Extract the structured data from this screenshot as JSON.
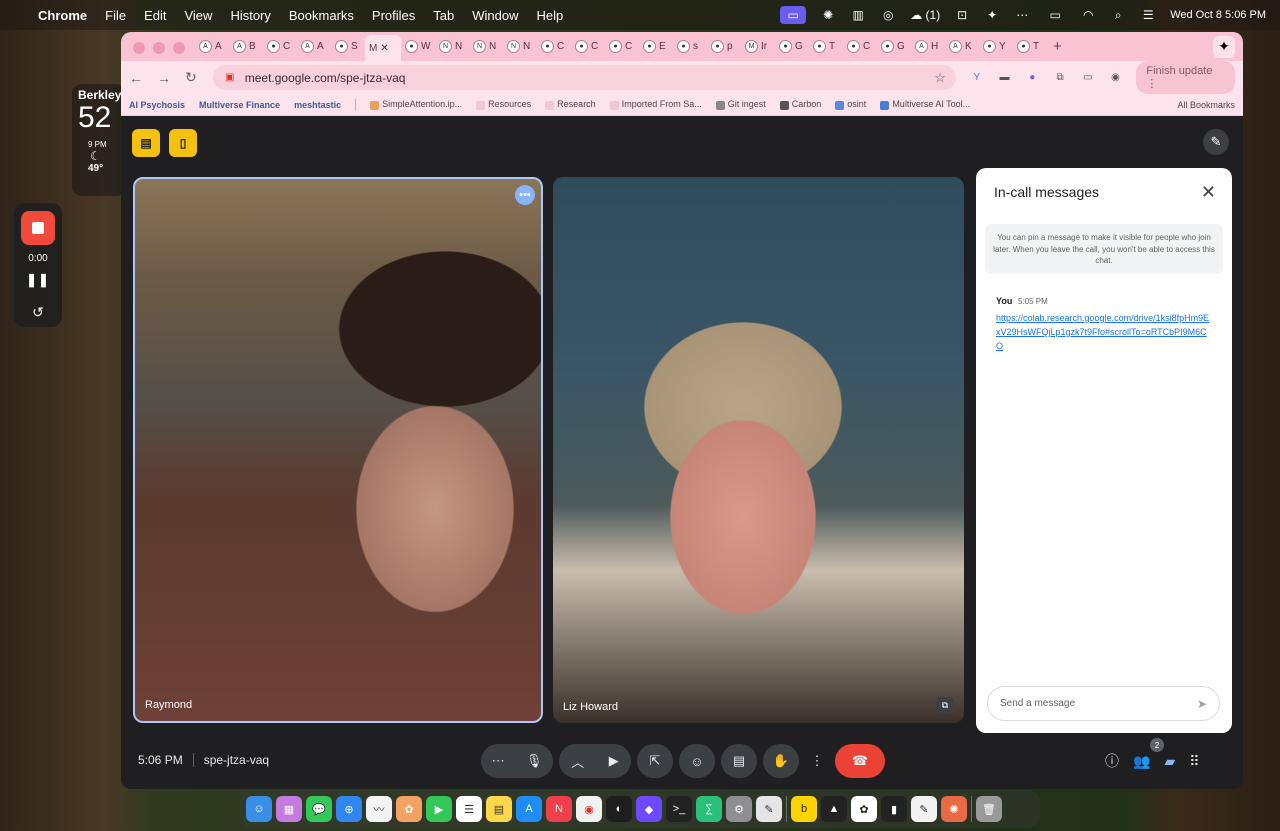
{
  "menubar": {
    "app_name": "Chrome",
    "menus": [
      "File",
      "Edit",
      "View",
      "History",
      "Bookmarks",
      "Profiles",
      "Tab",
      "Window",
      "Help"
    ],
    "status_item_count": "(1)",
    "datetime": "Wed Oct 8  5:06 PM"
  },
  "weather": {
    "city": "Berkley",
    "temp": "52",
    "hour": "9 PM",
    "hour_temp": "49°"
  },
  "recorder": {
    "time": "0:00"
  },
  "browser": {
    "tabs": [
      {
        "letter": "A",
        "fav": "A"
      },
      {
        "letter": "B",
        "fav": "A"
      },
      {
        "letter": "C",
        "fav": "●"
      },
      {
        "letter": "A",
        "fav": "A"
      },
      {
        "letter": "S",
        "fav": "●"
      },
      {
        "letter": "M",
        "fav": "",
        "active": true
      },
      {
        "letter": "W",
        "fav": "●"
      },
      {
        "letter": "N",
        "fav": "N"
      },
      {
        "letter": "N",
        "fav": "N"
      },
      {
        "letter": "N",
        "fav": "N"
      },
      {
        "letter": "C",
        "fav": "●"
      },
      {
        "letter": "C",
        "fav": "●"
      },
      {
        "letter": "C",
        "fav": "●"
      },
      {
        "letter": "E",
        "fav": "●"
      },
      {
        "letter": "s",
        "fav": "●"
      },
      {
        "letter": "p",
        "fav": "●"
      },
      {
        "letter": "Ir",
        "fav": "M"
      },
      {
        "letter": "G",
        "fav": "●"
      },
      {
        "letter": "T",
        "fav": "●"
      },
      {
        "letter": "C",
        "fav": "●"
      },
      {
        "letter": "G",
        "fav": "●"
      },
      {
        "letter": "H",
        "fav": "A"
      },
      {
        "letter": "K",
        "fav": "A"
      },
      {
        "letter": "Y",
        "fav": "●"
      },
      {
        "letter": "T",
        "fav": "●"
      }
    ],
    "url": "meet.google.com/spe-jtza-vaq",
    "finish_update": "Finish update",
    "bookmarks": [
      "AI Psychosis",
      "Multiverse Finance",
      "meshtastic",
      "SimpleAttention.ip...",
      "Resources",
      "Research",
      "Imported From Sa...",
      "Git ingest",
      "Carbon",
      "osint",
      "Multiverse AI Tool..."
    ],
    "all_bookmarks": "All Bookmarks"
  },
  "meet": {
    "participants": [
      {
        "name": "Raymond"
      },
      {
        "name": "Liz Howard"
      }
    ],
    "time": "5:06 PM",
    "meeting_code": "spe-jtza-vaq",
    "people_count": "2",
    "chat": {
      "title": "In-call messages",
      "info": "You can pin a message to make it visible for people who join later. When you leave the call, you won't be able to access this chat.",
      "messages": [
        {
          "sender": "You",
          "time": "5:05 PM",
          "text": "https://colab.research.google.com/drive/1ksi8fpHm9ExV29HsWFQjLp1gzk7t9Ffo#scrollTo=oRTCbPI9M6CO"
        }
      ],
      "input_placeholder": "Send a message"
    }
  },
  "colors": {
    "tabstrip": "#f9c3d3",
    "toolbar": "#fde3eb",
    "meet_bg": "#1f1f22",
    "end_call": "#ea4335",
    "active_speaker_border": "#a8c7fa",
    "link": "#1a73e8"
  },
  "icons": {
    "menubar_right": [
      "stage-manager-icon",
      "brightness-icon",
      "stats-icon",
      "spiral-icon",
      "cloud-icon",
      "vpn-icon",
      "sparkle-icon",
      "dots-icon",
      "battery-icon",
      "wifi-icon",
      "search-icon",
      "control-center-icon"
    ],
    "dock": [
      "finder-icon",
      "launchpad-icon",
      "messages-icon",
      "safari-icon",
      "freeform-icon",
      "photos-icon",
      "facetime-icon",
      "reminders-icon",
      "notes-icon",
      "app-store-icon",
      "news-icon",
      "chrome-icon",
      "chatgpt-icon",
      "proton-icon",
      "terminal-icon",
      "mathway-icon",
      "settings-icon",
      "pencil-icon",
      "bing-icon",
      "cursor-icon",
      "openai-icon",
      "audio-icon",
      "textedit-icon",
      "claude-icon",
      "trash-icon"
    ]
  }
}
